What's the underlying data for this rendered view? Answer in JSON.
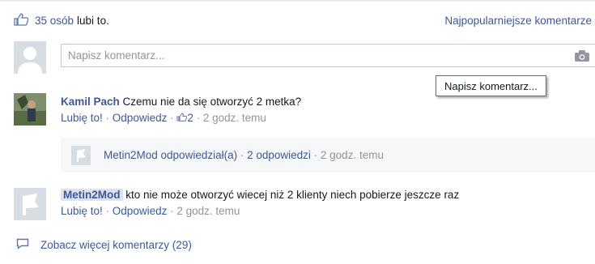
{
  "likes": {
    "count_text": "35 osób",
    "suffix": "lubi to.",
    "sort_label": "Najpopularniejsze komentarze"
  },
  "composer": {
    "placeholder": "Napisz komentarz...",
    "tooltip": "Napisz komentarz..."
  },
  "comments": [
    {
      "author": "Kamil Pach",
      "text": "Czemu nie da się otworzyć 2 metka?",
      "like_label": "Lubię to!",
      "reply_label": "Odpowiedz",
      "like_count": "2",
      "time": "2 godz. temu",
      "replies": {
        "author_text": "Metin2Mod odpowiedział(a)",
        "count_text": "2 odpowiedzi",
        "time": "2 godz. temu"
      }
    },
    {
      "author": "Metin2Mod",
      "text": "kto nie może otworzyć wiecej niż 2 klienty niech pobierze jeszcze raz",
      "like_label": "Lubię to!",
      "reply_label": "Odpowiedz",
      "time": "2 godz. temu"
    }
  ],
  "more": {
    "label": "Zobacz więcej komentarzy (29)"
  }
}
